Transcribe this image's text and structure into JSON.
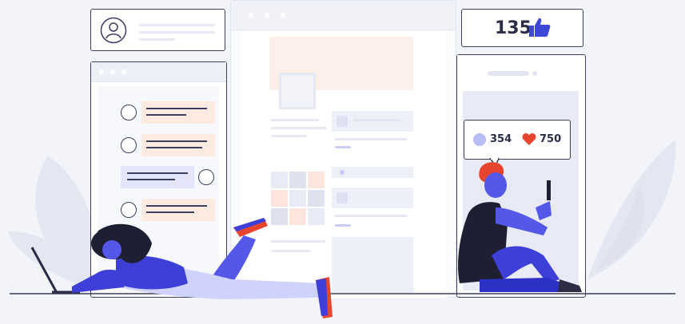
{
  "likes": {
    "count": "135",
    "icon": "thumbs-up-icon",
    "color": "#3d49d6"
  },
  "social_bubble": {
    "comments": "354",
    "hearts": "750",
    "comment_icon": "comment-bubble-icon",
    "heart_icon": "heart-icon",
    "heart_color": "#e8452f",
    "comment_color": "#b9bdf6"
  },
  "profile_card": {
    "icon": "user-avatar-icon"
  },
  "palette": {
    "accent_blue": "#3d3fd6",
    "accent_red": "#e8452f",
    "ink": "#2a2d45",
    "peach": "#fdebe2",
    "lavender": "#e3e5fa"
  }
}
